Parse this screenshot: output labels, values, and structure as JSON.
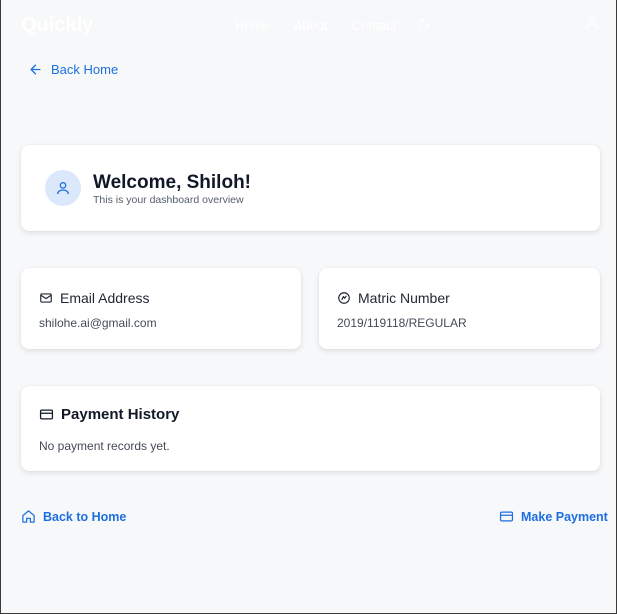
{
  "nav": {
    "brand": "Quickly",
    "links": [
      "Home",
      "About",
      "Contact"
    ],
    "theme_icon": "moon-icon",
    "user_icon": "user-icon"
  },
  "back_top": {
    "label": "Back Home",
    "icon": "arrow-left-icon"
  },
  "welcome": {
    "title": "Welcome, Shiloh!",
    "subtitle": "This is your dashboard overview",
    "icon": "user-icon"
  },
  "email": {
    "heading": "Email Address",
    "value": "shilohe.ai@gmail.com",
    "icon": "mail-icon"
  },
  "matric": {
    "heading": "Matric Number",
    "value": "2019/119118/REGULAR",
    "icon": "badge-check-icon"
  },
  "payment_history": {
    "heading": "Payment History",
    "empty_text": "No payment records yet.",
    "icon": "credit-card-icon"
  },
  "footer": {
    "back_home": "Back to Home",
    "make_payment": "Make Payment"
  },
  "colors": {
    "accent": "#1d6fe0",
    "background": "#f7f8fa",
    "avatar_bg": "#dbe8fb"
  }
}
